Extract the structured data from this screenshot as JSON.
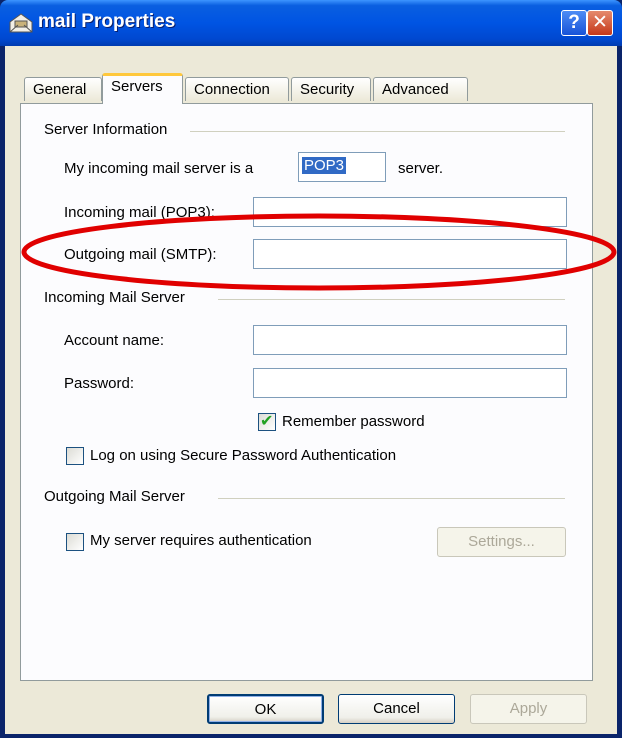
{
  "window": {
    "title": "mail Properties",
    "help_symbol": "?",
    "close_symbol": "✕"
  },
  "tabs": [
    {
      "label": "General"
    },
    {
      "label": "Servers"
    },
    {
      "label": "Connection"
    },
    {
      "label": "Security"
    },
    {
      "label": "Advanced"
    }
  ],
  "server_info": {
    "group_title": "Server Information",
    "incoming_type_prefix": "My incoming mail server is a",
    "incoming_type_value": "POP3",
    "incoming_type_suffix": "server.",
    "incoming_label": "Incoming mail (POP3):",
    "incoming_value": "",
    "outgoing_label": "Outgoing mail (SMTP):",
    "outgoing_value": ""
  },
  "incoming_server": {
    "group_title": "Incoming Mail Server",
    "account_label": "Account name:",
    "account_value": "",
    "password_label": "Password:",
    "password_value": "",
    "remember_label": "Remember password",
    "remember_checked": true,
    "spa_label": "Log on using Secure Password Authentication",
    "spa_checked": false
  },
  "outgoing_server": {
    "group_title": "Outgoing Mail Server",
    "auth_label": "My server requires authentication",
    "auth_checked": false,
    "settings_label": "Settings..."
  },
  "buttons": {
    "ok": "OK",
    "cancel": "Cancel",
    "apply": "Apply"
  },
  "annotation": {
    "color": "#e00000"
  }
}
